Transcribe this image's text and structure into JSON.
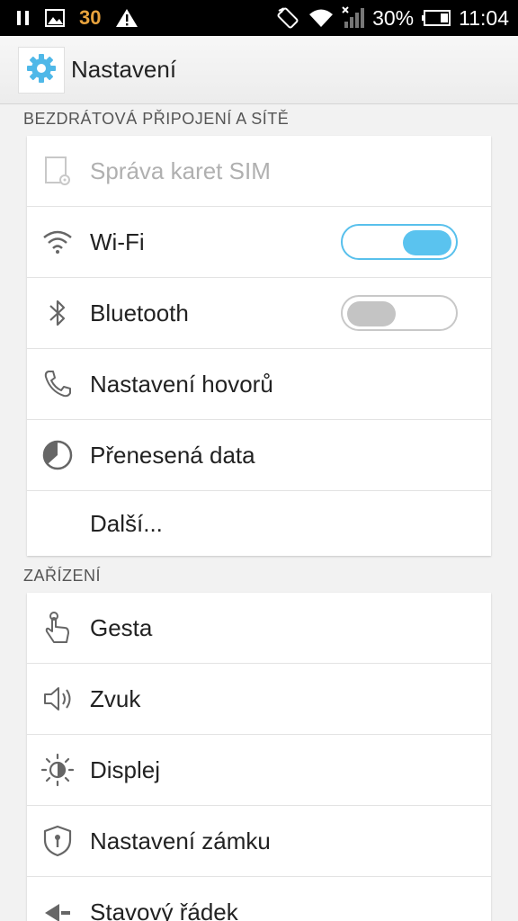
{
  "status_bar": {
    "notification_count": "30",
    "battery_percent": "30%",
    "time": "11:04"
  },
  "header": {
    "title": "Nastavení",
    "icon": "gear-icon"
  },
  "sections": {
    "wireless": {
      "title": "BEZDRÁTOVÁ PŘIPOJENÍ A SÍTĚ",
      "items": [
        {
          "label": "Správa karet SIM",
          "icon": "sim-card-icon",
          "enabled": false
        },
        {
          "label": "Wi-Fi",
          "icon": "wifi-icon",
          "toggle": "on"
        },
        {
          "label": "Bluetooth",
          "icon": "bluetooth-icon",
          "toggle": "off"
        },
        {
          "label": "Nastavení hovorů",
          "icon": "phone-icon"
        },
        {
          "label": "Přenesená data",
          "icon": "data-usage-icon"
        },
        {
          "label": "Další...",
          "icon": null
        }
      ]
    },
    "device": {
      "title": "ZAŘÍZENÍ",
      "items": [
        {
          "label": "Gesta",
          "icon": "gesture-hand-icon"
        },
        {
          "label": "Zvuk",
          "icon": "speaker-icon"
        },
        {
          "label": "Displej",
          "icon": "brightness-icon"
        },
        {
          "label": "Nastavení zámku",
          "icon": "lock-shield-icon"
        },
        {
          "label": "Stavový řádek",
          "icon": "status-bar-icon"
        }
      ]
    }
  },
  "colors": {
    "accent": "#5ac3ef",
    "background": "#f2f2f2",
    "status_bar": "#000000",
    "notification_count": "#e8a33d"
  }
}
